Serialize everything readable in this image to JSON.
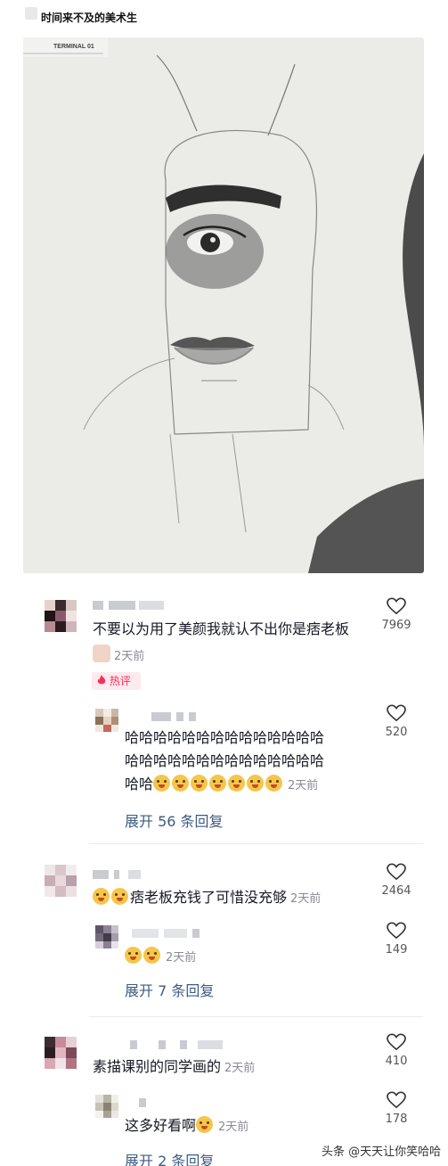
{
  "post": {
    "title": "时间来不及的美术生",
    "image_label": "TERMINAL 01"
  },
  "comments": [
    {
      "text": "不要以为用了美颜我就认不出你是痞老板",
      "time": "2天前",
      "likes": "7969",
      "badge": "热评",
      "replies": [
        {
          "line1": "哈哈哈哈哈哈哈哈哈哈哈哈哈哈",
          "line2": "哈哈哈哈哈哈哈哈哈哈哈哈哈哈",
          "line3": "哈哈",
          "time": "2天前",
          "likes": "520"
        }
      ],
      "expand": "展开 56 条回复"
    },
    {
      "text": "痞老板充钱了可惜没充够",
      "time": "2天前",
      "likes": "2464",
      "replies": [
        {
          "time": "2天前",
          "likes": "149"
        }
      ],
      "expand": "展开 7 条回复"
    },
    {
      "text": "素描课别的同学画的",
      "time": "2天前",
      "likes": "410",
      "replies": [
        {
          "text": "这多好看啊",
          "time": "2天前",
          "likes": "178"
        }
      ],
      "expand": "展开 2 条回复"
    }
  ],
  "watermark": "头条 @天天让你笑哈哈",
  "icons": {
    "like": "heart-outline-icon",
    "hot": "flame-icon",
    "emoji": "laughing-face-emoji-icon"
  },
  "colors": {
    "link": "#3c5b80",
    "hot": "#fe2c55",
    "meta": "#8a8b91"
  }
}
